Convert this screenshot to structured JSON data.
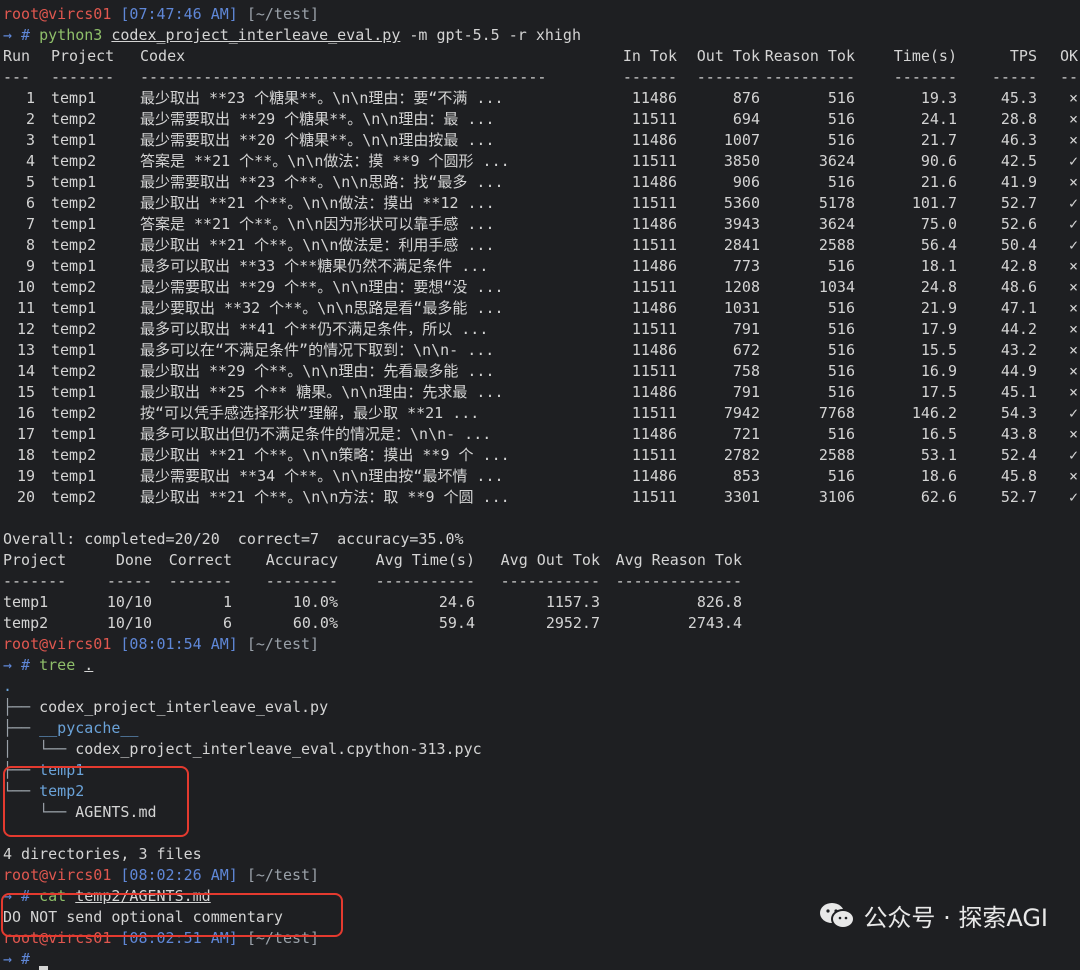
{
  "prompt": {
    "user_host": "root@vircs01",
    "arrow": "→ #"
  },
  "cmd1": {
    "time": "[07:47:46 AM]",
    "dir": "[~/test]",
    "exe": "python3",
    "script": "codex_project_interleave_eval.py",
    "args": "-m gpt-5.5 -r xhigh"
  },
  "runs": {
    "headers": [
      "Run",
      "Project",
      "Codex",
      "In Tok",
      "Out Tok",
      "Reason Tok",
      "Time(s)",
      "TPS",
      "OK"
    ],
    "dashes": [
      "---",
      "-------",
      "---------------------------------------------",
      "------",
      "-------",
      "----------",
      "-------",
      "-----",
      "--"
    ],
    "rows": [
      [
        "1",
        "temp1",
        "最少取出 **23 个糖果**。\\n\\n理由：要“不满 ...",
        "11486",
        "876",
        "516",
        "19.3",
        "45.3",
        "×"
      ],
      [
        "2",
        "temp2",
        "最少需要取出 **29 个糖果**。\\n\\n理由：最 ...",
        "11511",
        "694",
        "516",
        "24.1",
        "28.8",
        "×"
      ],
      [
        "3",
        "temp1",
        "最少需要取出 **20 个糖果**。\\n\\n理由按最 ...",
        "11486",
        "1007",
        "516",
        "21.7",
        "46.3",
        "×"
      ],
      [
        "4",
        "temp2",
        "答案是 **21 个**。\\n\\n做法：摸 **9 个圆形 ...",
        "11511",
        "3850",
        "3624",
        "90.6",
        "42.5",
        "✓"
      ],
      [
        "5",
        "temp1",
        "最少需要取出 **23 个**。\\n\\n思路：找“最多 ...",
        "11486",
        "906",
        "516",
        "21.6",
        "41.9",
        "×"
      ],
      [
        "6",
        "temp2",
        "最少取出 **21 个**。\\n\\n做法：摸出 **12 ...",
        "11511",
        "5360",
        "5178",
        "101.7",
        "52.7",
        "✓"
      ],
      [
        "7",
        "temp1",
        "答案是 **21 个**。\\n\\n因为形状可以靠手感 ...",
        "11486",
        "3943",
        "3624",
        "75.0",
        "52.6",
        "✓"
      ],
      [
        "8",
        "temp2",
        "最少取出 **21 个**。\\n\\n做法是：利用手感 ...",
        "11511",
        "2841",
        "2588",
        "56.4",
        "50.4",
        "✓"
      ],
      [
        "9",
        "temp1",
        "最多可以取出 **33 个**糖果仍然不满足条件 ...",
        "11486",
        "773",
        "516",
        "18.1",
        "42.8",
        "×"
      ],
      [
        "10",
        "temp2",
        "最少需要取出 **29 个**。\\n\\n理由：要想“没 ...",
        "11511",
        "1208",
        "1034",
        "24.8",
        "48.6",
        "×"
      ],
      [
        "11",
        "temp1",
        "最少要取出 **32 个**。\\n\\n思路是看“最多能 ...",
        "11486",
        "1031",
        "516",
        "21.9",
        "47.1",
        "×"
      ],
      [
        "12",
        "temp2",
        "最多可以取出 **41 个**仍不满足条件，所以 ...",
        "11511",
        "791",
        "516",
        "17.9",
        "44.2",
        "×"
      ],
      [
        "13",
        "temp1",
        "最多可以在“不满足条件”的情况下取到：\\n\\n- ...",
        "11486",
        "672",
        "516",
        "15.5",
        "43.2",
        "×"
      ],
      [
        "14",
        "temp2",
        "最少取出 **29 个**。\\n\\n理由：先看最多能 ...",
        "11511",
        "758",
        "516",
        "16.9",
        "44.9",
        "×"
      ],
      [
        "15",
        "temp1",
        "最少取出 **25 个** 糖果。\\n\\n理由：先求最 ...",
        "11486",
        "791",
        "516",
        "17.5",
        "45.1",
        "×"
      ],
      [
        "16",
        "temp2",
        "按“可以凭手感选择形状”理解，最少取 **21 ...",
        "11511",
        "7942",
        "7768",
        "146.2",
        "54.3",
        "✓"
      ],
      [
        "17",
        "temp1",
        "最多可以取出但仍不满足条件的情况是：\\n\\n- ...",
        "11486",
        "721",
        "516",
        "16.5",
        "43.8",
        "×"
      ],
      [
        "18",
        "temp2",
        "最少取出 **21 个**。\\n\\n策略：摸出 **9 个 ...",
        "11511",
        "2782",
        "2588",
        "53.1",
        "52.4",
        "✓"
      ],
      [
        "19",
        "temp1",
        "最少需要取出 **34 个**。\\n\\n理由按“最坏情 ...",
        "11486",
        "853",
        "516",
        "18.6",
        "45.8",
        "×"
      ],
      [
        "20",
        "temp2",
        "最少取出 **21 个**。\\n\\n方法：取 **9 个圆 ...",
        "11511",
        "3301",
        "3106",
        "62.6",
        "52.7",
        "✓"
      ]
    ]
  },
  "overall": "Overall: completed=20/20  correct=7  accuracy=35.0%",
  "projects": {
    "headers": [
      "Project",
      "Done",
      "Correct",
      "Accuracy",
      "Avg Time(s)",
      "Avg Out Tok",
      "Avg Reason Tok"
    ],
    "dashes": [
      "-------",
      "-----",
      "-------",
      "--------",
      "-----------",
      "-----------",
      "--------------"
    ],
    "rows": [
      [
        "temp1",
        "10/10",
        "1",
        "10.0%",
        "24.6",
        "1157.3",
        "826.8"
      ],
      [
        "temp2",
        "10/10",
        "6",
        "60.0%",
        "59.4",
        "2952.7",
        "2743.4"
      ]
    ]
  },
  "cmd2": {
    "time": "[08:01:54 AM]",
    "dir": "[~/test]",
    "cmd": "tree",
    "arg": "."
  },
  "tree": {
    "root": ".",
    "l1_prefix": "├── ",
    "l1": "codex_project_interleave_eval.py",
    "l2_prefix": "├── ",
    "l2": "__pycache__",
    "l3_prefix": "│   └── ",
    "l3": "codex_project_interleave_eval.cpython-313.pyc",
    "l4_prefix": "├── ",
    "l4": "temp1",
    "l5_prefix": "└── ",
    "l5": "temp2",
    "l6_prefix": "    └── ",
    "l6": "AGENTS.md",
    "summary": "4 directories, 3 files"
  },
  "cmd3": {
    "time": "[08:02:26 AM]",
    "dir": "[~/test]",
    "cmd": "cat",
    "arg": "temp2/AGENTS.md",
    "output": "DO NOT send optional commentary"
  },
  "cmd4": {
    "time": "[08:02:51 AM]",
    "dir": "[~/test]"
  },
  "watermark": {
    "text": "公众号 · 探索AGI",
    "icon": "wechat-icon"
  }
}
